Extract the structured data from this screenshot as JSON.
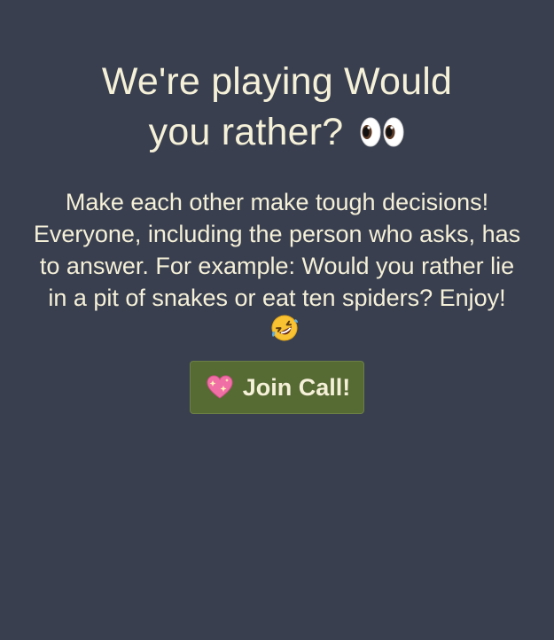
{
  "title": {
    "text": "We're playing Would you rather?",
    "icon": "eyes-emoji-icon"
  },
  "description": {
    "text": "Make each other make tough decisions! Everyone, including the person who asks, has to answer. For example: Would you rather lie in a pit of snakes or eat ten spiders? Enjoy!",
    "icon": "rolling-on-floor-laughing-emoji-icon"
  },
  "join_button": {
    "label": "Join Call!",
    "icon": "sparkling-heart-emoji-icon",
    "background": "#566a34"
  },
  "colors": {
    "background": "#393f4f",
    "text": "#f5f0d8"
  }
}
